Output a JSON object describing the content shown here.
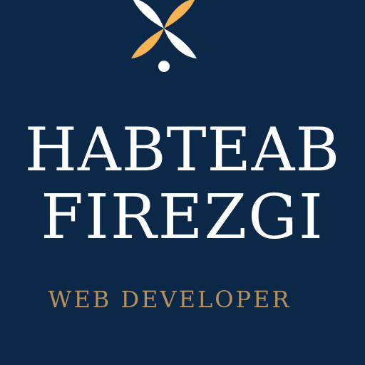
{
  "brand": {
    "name_line_1": "HABTEAB",
    "name_line_2": "FIREZGI",
    "role": "WEB DEVELOPER"
  },
  "logo": {
    "icon": "four-petal-flower-icon",
    "petal_light": "#ffffff",
    "petal_accent": "#f5b351"
  },
  "colors": {
    "background": "#0b2849",
    "name_text": "#ffffff",
    "role_text": "#b8905a"
  }
}
